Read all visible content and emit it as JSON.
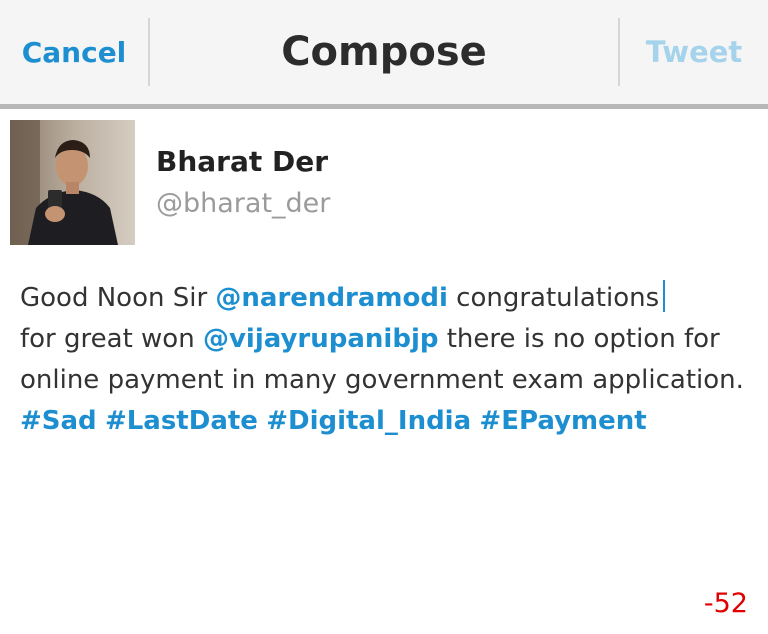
{
  "header": {
    "cancel_label": "Cancel",
    "title": "Compose",
    "tweet_label": "Tweet"
  },
  "user": {
    "name": "Bharat Der",
    "handle": "@bharat_der"
  },
  "compose": {
    "segments": [
      {
        "text": "Good Noon Sir ",
        "type": "text"
      },
      {
        "text": "@narendramodi",
        "type": "mention"
      },
      {
        "text": "  congratulations",
        "type": "text"
      },
      {
        "text": " for great won ",
        "type": "text"
      },
      {
        "text": "@vijayrupanibjp",
        "type": "mention"
      },
      {
        "text": "  there is no option for online payment in many government exam application. ",
        "type": "text"
      },
      {
        "text": "#Sad",
        "type": "hashtag"
      },
      {
        "text": " ",
        "type": "text"
      },
      {
        "text": "#LastDate",
        "type": "hashtag"
      },
      {
        "text": " ",
        "type": "text"
      },
      {
        "text": "#Digital_India",
        "type": "hashtag"
      },
      {
        "text": " ",
        "type": "text"
      },
      {
        "text": "#EPayment",
        "type": "hashtag"
      }
    ]
  },
  "char_counter": "-52",
  "colors": {
    "link": "#1d8fd0",
    "tweet_disabled": "#a6d3ec",
    "counter_over": "#e00000"
  }
}
